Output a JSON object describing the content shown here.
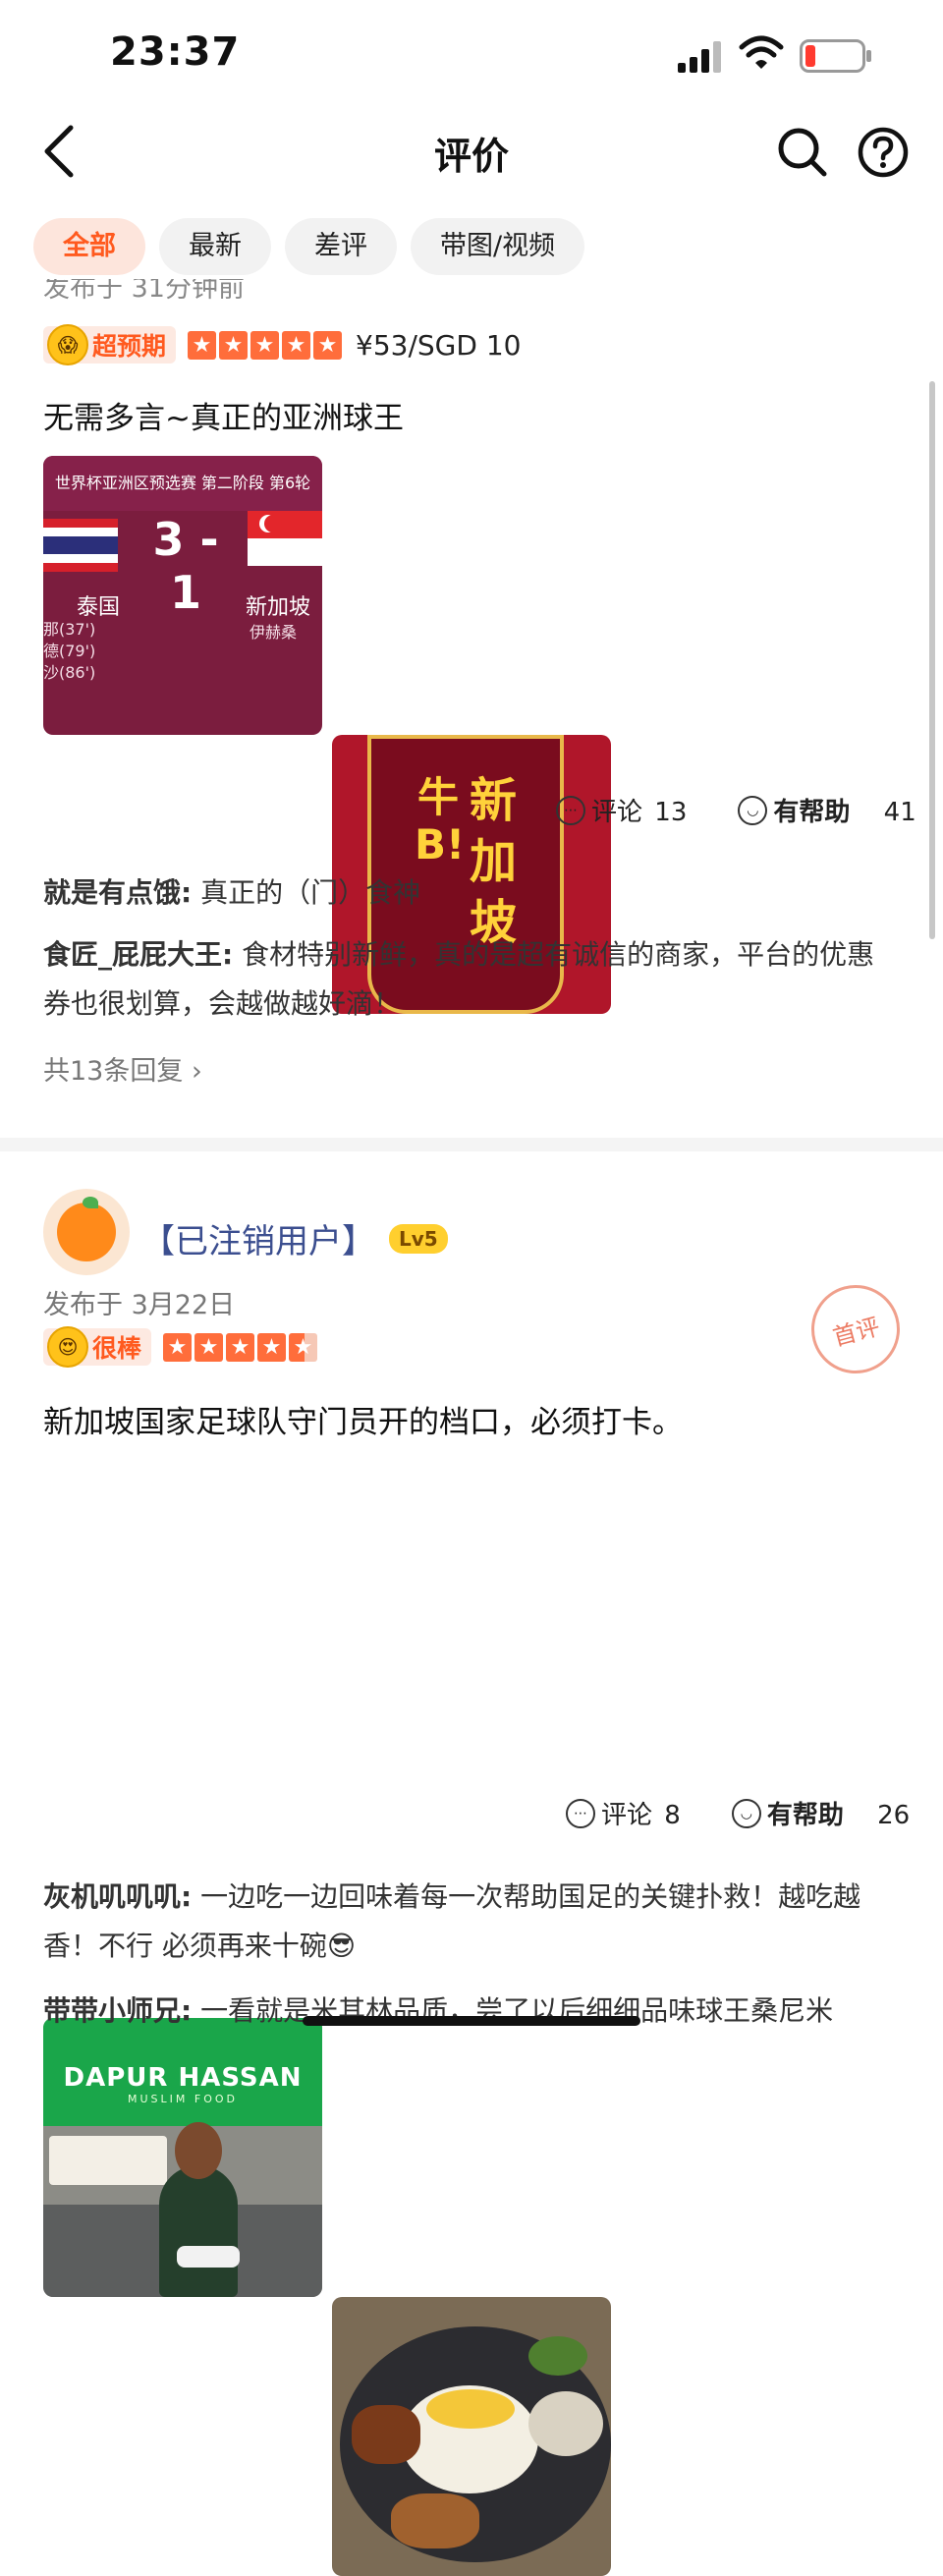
{
  "status_bar": {
    "time": "23:37"
  },
  "nav": {
    "title": "评价"
  },
  "tabs": [
    "全部",
    "最新",
    "差评",
    "带图/视频"
  ],
  "review1": {
    "partial_meta": "发布于 31分钟前",
    "rating_label": "超预期",
    "stars": 5,
    "price": "¥53/SGD 10",
    "text": "无需多言~真正的亚洲球王",
    "image1": {
      "header": "世界杯亚洲区预选赛 第二阶段 第6轮",
      "score": "3 - 1",
      "team_left": "泰国",
      "team_right": "新加坡",
      "scorers_left": [
        "那(37')",
        "德(79')",
        "沙(86')"
      ],
      "scorer_right": "伊赫桑"
    },
    "image2": {
      "big_text_right": "新加坡",
      "big_text_left": "牛B!"
    },
    "comments_label": "评论",
    "comments_count": "13",
    "helpful_label": "有帮助",
    "helpful_count": "41",
    "replies": [
      {
        "author": "就是有点饿:",
        "text": "真正的（门）食神"
      },
      {
        "author": "食匠_屁屁大王:",
        "text": "食材特别新鲜，真的是超有诚信的商家，平台的优惠券也很划算，会越做越好滴！"
      }
    ],
    "more_replies": "共13条回复"
  },
  "review2": {
    "username": "【已注销用户】",
    "level": "Lv5",
    "date": "发布于 3月22日",
    "rating_label": "很棒",
    "stars": 4.5,
    "stamp": "首评",
    "text": "新加坡国家足球队守门员开的档口，必须打卡。",
    "image1": {
      "sign": "DAPUR HASSAN",
      "sign_sub": "MUSLIM FOOD"
    },
    "comments_label": "评论",
    "comments_count": "8",
    "helpful_label": "有帮助",
    "helpful_count": "26",
    "replies": [
      {
        "author": "灰机叽叽叽:",
        "text": "一边吃一边回味着每一次帮助国足的关键扑救！越吃越香！不行 必须再来十碗😎"
      },
      {
        "author": "带带小师兄:",
        "text": "一看就是米其林品质，尝了以后细细品味球王桑尼米"
      }
    ]
  }
}
